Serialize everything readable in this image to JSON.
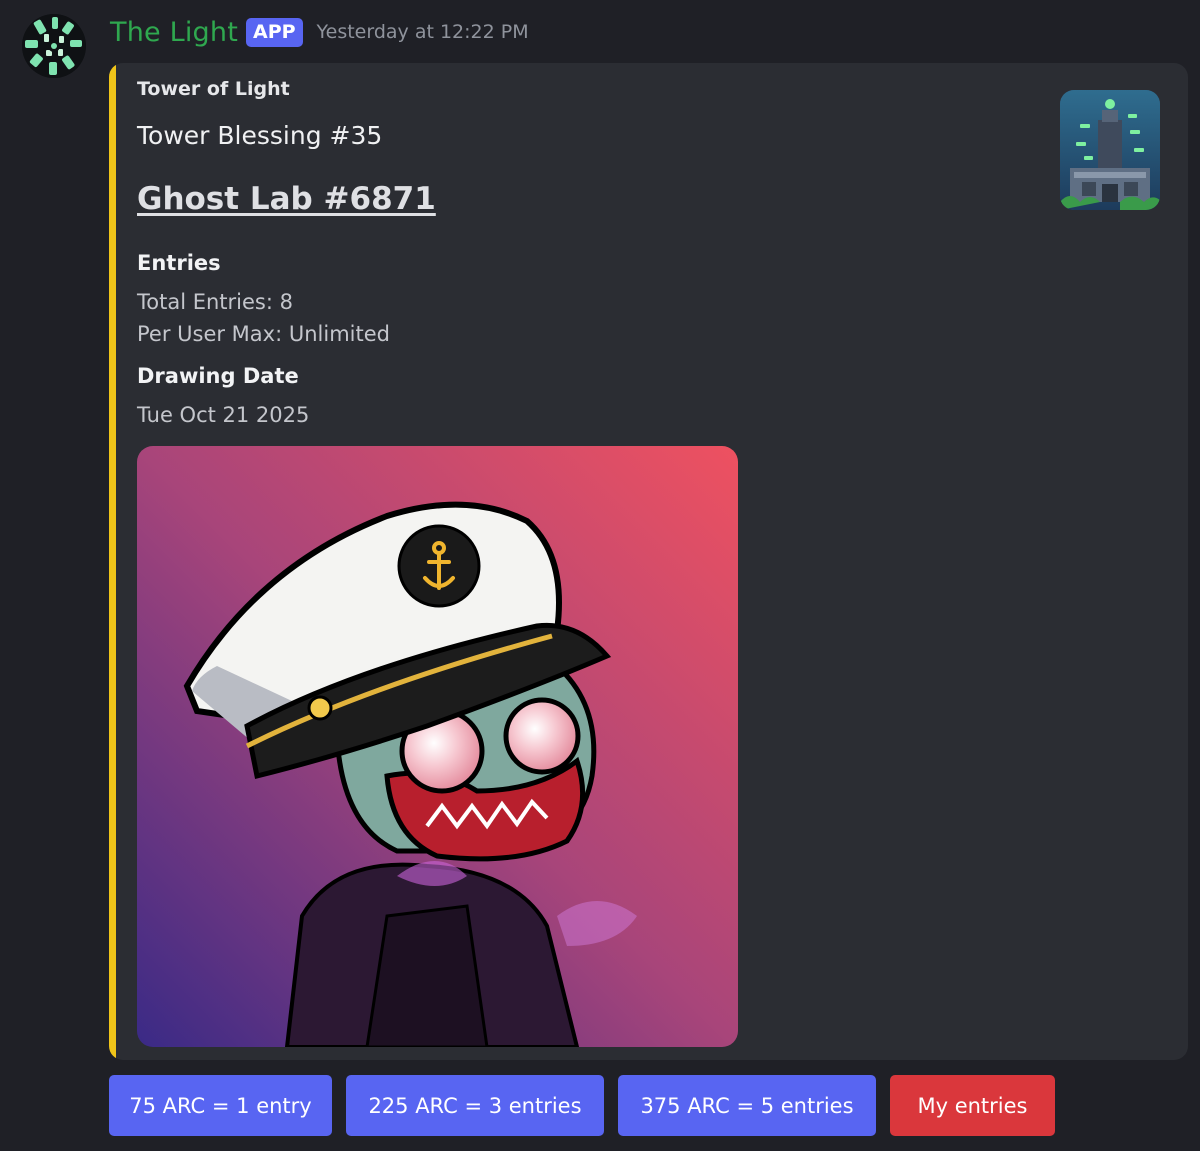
{
  "message": {
    "author": "The Light",
    "badge": "APP",
    "timestamp": "Yesterday at 12:22 PM"
  },
  "embed": {
    "accent_color": "#f0c419",
    "author": "Tower of Light",
    "title": "Tower Blessing #35",
    "link_title": "Ghost Lab #6871",
    "fields": [
      {
        "name": "Entries",
        "lines": [
          "Total Entries: 8",
          "Per User Max: Unlimited"
        ]
      },
      {
        "name": "Drawing Date",
        "lines": [
          "Tue Oct 21 2025"
        ]
      }
    ]
  },
  "buttons": [
    {
      "label": "75 ARC = 1 entry",
      "style": "primary",
      "color": "#5865f2"
    },
    {
      "label": "225 ARC = 3 entries",
      "style": "primary",
      "color": "#5865f2"
    },
    {
      "label": "375 ARC = 5 entries",
      "style": "primary",
      "color": "#5865f2"
    },
    {
      "label": "My entries",
      "style": "danger",
      "color": "#da373c"
    }
  ],
  "colors": {
    "background": "#1f2026",
    "embed_background": "#2b2d33",
    "author_name": "#2fa84f",
    "app_badge": "#5865f2"
  },
  "icons": {
    "avatar": "the-light-logo-icon",
    "thumbnail": "tower-of-light-icon",
    "main_image": "ghost-lab-captain-nft"
  }
}
